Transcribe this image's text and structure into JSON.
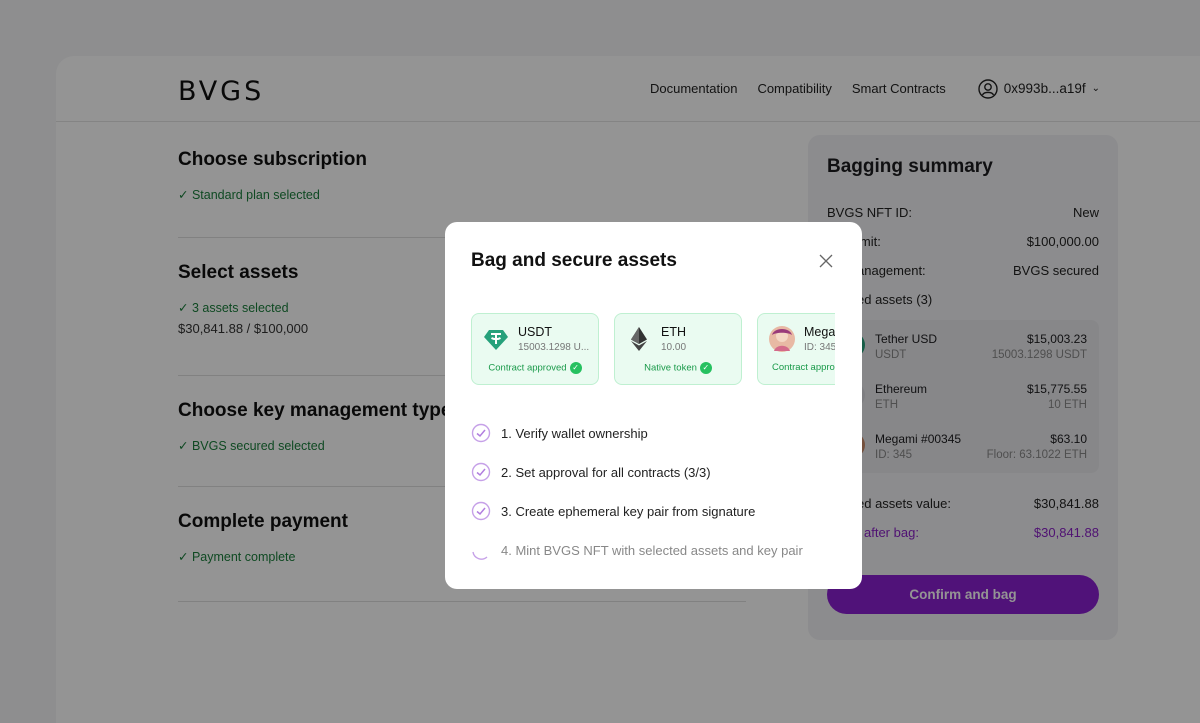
{
  "header": {
    "logo": "BVGS",
    "nav": [
      "Documentation",
      "Compatibility",
      "Smart Contracts"
    ],
    "wallet": "0x993b...a19f"
  },
  "steps": [
    {
      "title": "Choose subscription",
      "status": "✓ Standard plan selected",
      "sub": ""
    },
    {
      "title": "Select assets",
      "status": "✓ 3 assets selected",
      "sub": "$30,841.88 / $100,000"
    },
    {
      "title": "Choose key management type",
      "status": "✓ BVGS secured selected",
      "sub": ""
    },
    {
      "title": "Complete payment",
      "status": "✓ Payment complete",
      "sub": ""
    }
  ],
  "summary": {
    "title": "Bagging summary",
    "nft_id_label": "BVGS NFT ID:",
    "nft_id_value": "New",
    "limit_label": "imit:",
    "limit_value": "$100,000.00",
    "mgmt_label": "anagement:",
    "mgmt_value": "BVGS secured",
    "assets_label": "ed assets (3)",
    "assets": [
      {
        "name": "Tether USD",
        "symbol": "USDT",
        "value": "$15,003.23",
        "amount": "15003.1298 USDT"
      },
      {
        "name": "Ethereum",
        "symbol": "ETH",
        "value": "$15,775.55",
        "amount": "10 ETH"
      },
      {
        "name": "Megami #00345",
        "symbol": "ID: 345",
        "value": "$63.10",
        "amount": "Floor: 63.1022 ETH"
      }
    ],
    "total_label": "ed assets value:",
    "total_value": "$30,841.88",
    "after_label": "after bag:",
    "after_value": "$30,841.88",
    "confirm": "Confirm and bag"
  },
  "modal": {
    "title": "Bag and secure assets",
    "cards": [
      {
        "name": "USDT",
        "amount": "15003.1298 U...",
        "status": "Contract approved"
      },
      {
        "name": "ETH",
        "amount": "10.00",
        "status": "Native token"
      },
      {
        "name": "Megan",
        "amount": "ID: 345",
        "status": "Contract appro"
      }
    ],
    "steps": [
      {
        "label": "1. Verify wallet ownership",
        "state": "done"
      },
      {
        "label": "2. Set approval for all contracts (3/3)",
        "state": "done"
      },
      {
        "label": "3. Create ephemeral key pair from signature",
        "state": "done"
      },
      {
        "label": "4. Mint BVGS NFT with selected assets and key pair",
        "state": "pending"
      }
    ]
  },
  "colors": {
    "accent": "#8b1fd0",
    "success": "#1a7f3c",
    "tether": "#26a17b"
  }
}
